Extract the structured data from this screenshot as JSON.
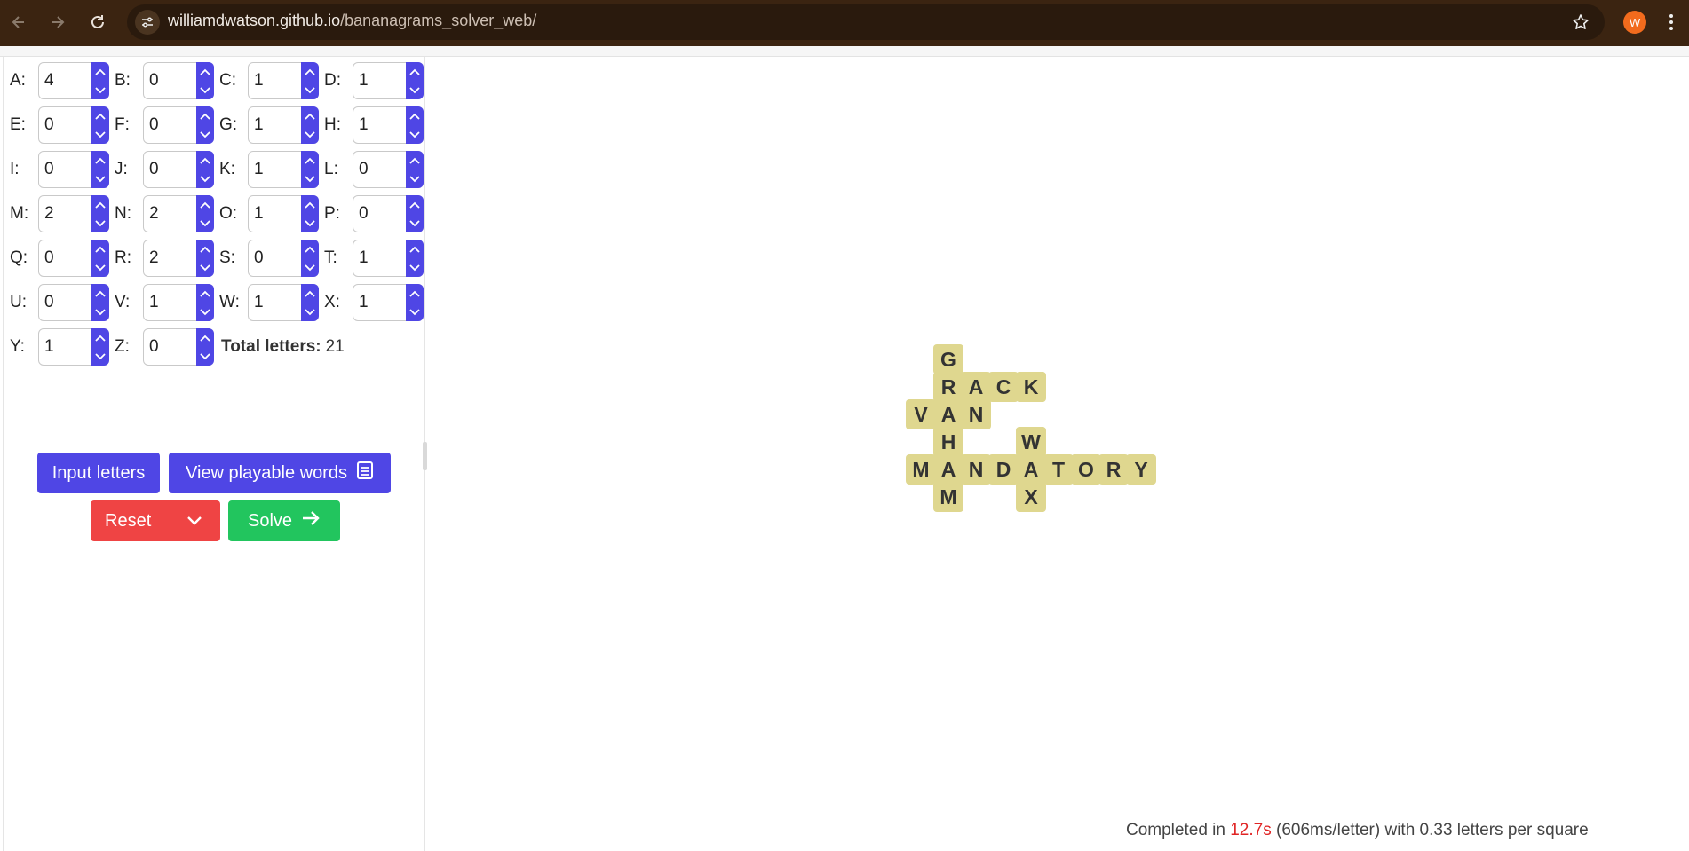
{
  "browser": {
    "url_host": "williamdwatson.github.io",
    "url_path": "/bananagrams_solver_web/",
    "avatar_letter": "W",
    "icons": [
      "back-arrow-icon",
      "forward-arrow-icon",
      "reload-icon",
      "site-info-icon",
      "bookmark-star-icon",
      "menu-kebab-icon"
    ]
  },
  "counters": [
    {
      "label": "A:",
      "value": "4"
    },
    {
      "label": "B:",
      "value": "0"
    },
    {
      "label": "C:",
      "value": "1"
    },
    {
      "label": "D:",
      "value": "1"
    },
    {
      "label": "E:",
      "value": "0"
    },
    {
      "label": "F:",
      "value": "0"
    },
    {
      "label": "G:",
      "value": "1"
    },
    {
      "label": "H:",
      "value": "1"
    },
    {
      "label": "I:",
      "value": "0"
    },
    {
      "label": "J:",
      "value": "0"
    },
    {
      "label": "K:",
      "value": "1"
    },
    {
      "label": "L:",
      "value": "0"
    },
    {
      "label": "M:",
      "value": "2"
    },
    {
      "label": "N:",
      "value": "2"
    },
    {
      "label": "O:",
      "value": "1"
    },
    {
      "label": "P:",
      "value": "0"
    },
    {
      "label": "Q:",
      "value": "0"
    },
    {
      "label": "R:",
      "value": "2"
    },
    {
      "label": "S:",
      "value": "0"
    },
    {
      "label": "T:",
      "value": "1"
    },
    {
      "label": "U:",
      "value": "0"
    },
    {
      "label": "V:",
      "value": "1"
    },
    {
      "label": "W:",
      "value": "1"
    },
    {
      "label": "X:",
      "value": "1"
    },
    {
      "label": "Y:",
      "value": "1"
    },
    {
      "label": "Z:",
      "value": "0"
    }
  ],
  "total": {
    "label": "Total letters:",
    "value": "21"
  },
  "buttons": {
    "input_letters": "Input letters",
    "view_playable_words": "View playable words",
    "reset": "Reset",
    "solve": "Solve"
  },
  "colors": {
    "accent": "#4f46e5",
    "reset": "#ef4444",
    "solve": "#22c55e",
    "tile": "#dfd78f",
    "chrome": "#3b2411"
  },
  "board": {
    "tiles": [
      {
        "letter": "G",
        "col": 1,
        "row": 0
      },
      {
        "letter": "R",
        "col": 1,
        "row": 1
      },
      {
        "letter": "A",
        "col": 2,
        "row": 1
      },
      {
        "letter": "C",
        "col": 3,
        "row": 1
      },
      {
        "letter": "K",
        "col": 4,
        "row": 1
      },
      {
        "letter": "V",
        "col": 0,
        "row": 2
      },
      {
        "letter": "A",
        "col": 1,
        "row": 2
      },
      {
        "letter": "N",
        "col": 2,
        "row": 2
      },
      {
        "letter": "H",
        "col": 1,
        "row": 3
      },
      {
        "letter": "W",
        "col": 4,
        "row": 3
      },
      {
        "letter": "M",
        "col": 0,
        "row": 4
      },
      {
        "letter": "A",
        "col": 1,
        "row": 4
      },
      {
        "letter": "N",
        "col": 2,
        "row": 4
      },
      {
        "letter": "D",
        "col": 3,
        "row": 4
      },
      {
        "letter": "A",
        "col": 4,
        "row": 4
      },
      {
        "letter": "T",
        "col": 5,
        "row": 4
      },
      {
        "letter": "O",
        "col": 6,
        "row": 4
      },
      {
        "letter": "R",
        "col": 7,
        "row": 4
      },
      {
        "letter": "Y",
        "col": 8,
        "row": 4
      },
      {
        "letter": "M",
        "col": 1,
        "row": 5
      },
      {
        "letter": "X",
        "col": 4,
        "row": 5
      }
    ]
  },
  "status": {
    "prefix": "Completed in",
    "time": "12.7s",
    "suffix": "(606ms/letter) with 0.33 letters per square"
  }
}
